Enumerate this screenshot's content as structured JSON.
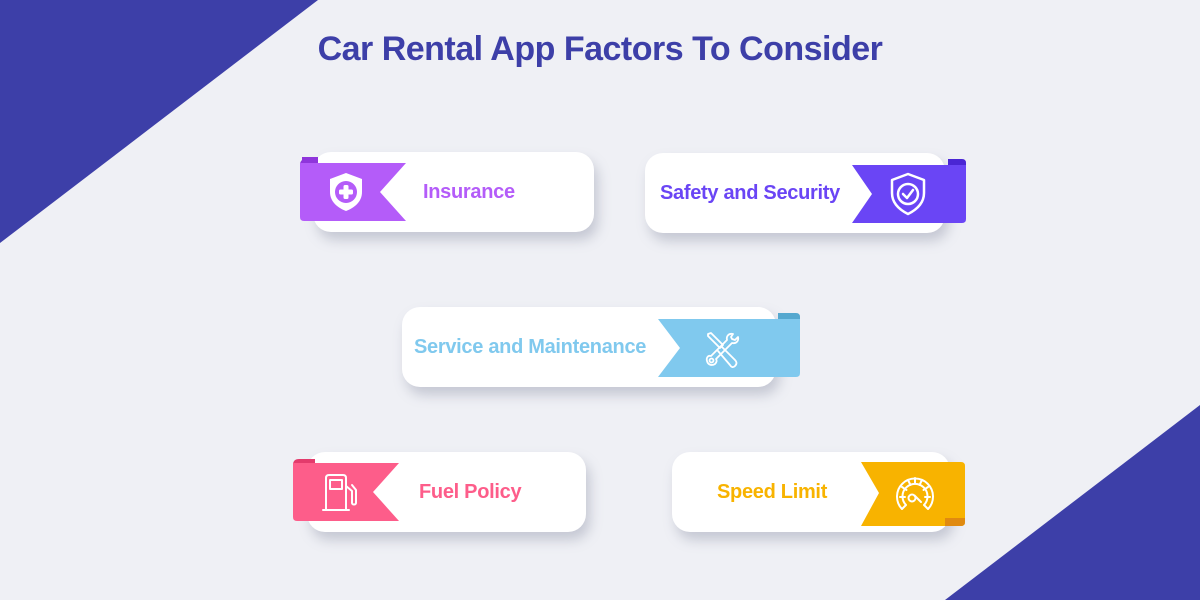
{
  "title": "Car Rental App Factors To Consider",
  "theme": {
    "background": "#eff0f5",
    "corner_accent": "#3d3fa8",
    "title_color": "#3d3fa8"
  },
  "factors": [
    {
      "label": "Insurance",
      "icon": "shield-plus-icon",
      "color": "#b45cf9",
      "fold_color": "#8f35db"
    },
    {
      "label": "Safety and Security",
      "icon": "shield-check-icon",
      "color": "#6a45f5",
      "fold_color": "#4a26d4"
    },
    {
      "label": "Service and Maintenance",
      "icon": "wrench-screwdriver-icon",
      "color": "#80c9ee",
      "fold_color": "#55a8cf"
    },
    {
      "label": "Fuel Policy",
      "icon": "fuel-pump-icon",
      "color": "#fd5d8a",
      "fold_color": "#e33b6c"
    },
    {
      "label": "Speed Limit",
      "icon": "speedometer-icon",
      "color": "#f8b300",
      "fold_color": "#e08a10"
    }
  ]
}
